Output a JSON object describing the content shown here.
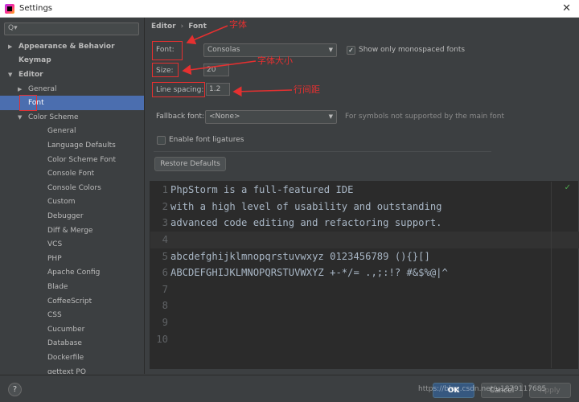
{
  "window": {
    "title": "Settings",
    "close_glyph": "✕"
  },
  "search": {
    "icon": "search-icon",
    "glyph": "Q▾"
  },
  "tree": [
    {
      "label": "Appearance & Behavior",
      "bold": true,
      "arrow": "▶",
      "indent": 0
    },
    {
      "label": "Keymap",
      "bold": true,
      "arrow": "",
      "indent": 0
    },
    {
      "label": "Editor",
      "bold": true,
      "arrow": "▼",
      "indent": 0
    },
    {
      "label": "General",
      "bold": false,
      "arrow": "▶",
      "indent": 1
    },
    {
      "label": "Font",
      "bold": false,
      "arrow": "",
      "indent": 1,
      "selected": true
    },
    {
      "label": "Color Scheme",
      "bold": false,
      "arrow": "▼",
      "indent": 1
    },
    {
      "label": "General",
      "bold": false,
      "arrow": "",
      "indent": 2
    },
    {
      "label": "Language Defaults",
      "bold": false,
      "arrow": "",
      "indent": 2
    },
    {
      "label": "Color Scheme Font",
      "bold": false,
      "arrow": "",
      "indent": 2
    },
    {
      "label": "Console Font",
      "bold": false,
      "arrow": "",
      "indent": 2
    },
    {
      "label": "Console Colors",
      "bold": false,
      "arrow": "",
      "indent": 2
    },
    {
      "label": "Custom",
      "bold": false,
      "arrow": "",
      "indent": 2
    },
    {
      "label": "Debugger",
      "bold": false,
      "arrow": "",
      "indent": 2
    },
    {
      "label": "Diff & Merge",
      "bold": false,
      "arrow": "",
      "indent": 2
    },
    {
      "label": "VCS",
      "bold": false,
      "arrow": "",
      "indent": 2
    },
    {
      "label": "PHP",
      "bold": false,
      "arrow": "",
      "indent": 2
    },
    {
      "label": "Apache Config",
      "bold": false,
      "arrow": "",
      "indent": 2
    },
    {
      "label": "Blade",
      "bold": false,
      "arrow": "",
      "indent": 2
    },
    {
      "label": "CoffeeScript",
      "bold": false,
      "arrow": "",
      "indent": 2
    },
    {
      "label": "CSS",
      "bold": false,
      "arrow": "",
      "indent": 2
    },
    {
      "label": "Cucumber",
      "bold": false,
      "arrow": "",
      "indent": 2
    },
    {
      "label": "Database",
      "bold": false,
      "arrow": "",
      "indent": 2
    },
    {
      "label": "Dockerfile",
      "bold": false,
      "arrow": "",
      "indent": 2
    },
    {
      "label": "gettext PO",
      "bold": false,
      "arrow": "",
      "indent": 2
    }
  ],
  "breadcrumb": {
    "editor": "Editor",
    "sep": "›",
    "font": "Font"
  },
  "font": {
    "label": "Font:",
    "value": "Consolas",
    "show_mono_label": "Show only monospaced fonts",
    "show_mono_checked": "✓"
  },
  "size": {
    "label": "Size:",
    "value": "20"
  },
  "line_spacing": {
    "label": "Line spacing:",
    "value": "1.2"
  },
  "fallback": {
    "label": "Fallback font:",
    "value": "<None>",
    "hint": "For symbols not supported by the main font"
  },
  "ligatures": {
    "label": "Enable font ligatures",
    "checked": ""
  },
  "restore_label": "Restore Defaults",
  "annotations": {
    "font": "字体",
    "size": "字体大小",
    "spacing": "行间距",
    "color": "#e53030"
  },
  "preview": {
    "lines": [
      {
        "n": "1",
        "text": "PhpStorm is a full-featured IDE"
      },
      {
        "n": "2",
        "text": "with a high level of usability and outstanding"
      },
      {
        "n": "3",
        "text": "advanced code editing and refactoring support."
      },
      {
        "n": "4",
        "text": ""
      },
      {
        "n": "5",
        "text": "abcdefghijklmnopqrstuvwxyz 0123456789 (){}[]"
      },
      {
        "n": "6",
        "text": "ABCDEFGHIJKLMNOPQRSTUVWXYZ +-*/= .,;:!? #&$%@|^"
      },
      {
        "n": "7",
        "text": ""
      },
      {
        "n": "8",
        "text": ""
      },
      {
        "n": "9",
        "text": ""
      },
      {
        "n": "10",
        "text": ""
      }
    ],
    "check_glyph": "✓"
  },
  "footer": {
    "help": "?",
    "ok": "OK",
    "cancel": "Cancel",
    "apply": "Apply"
  },
  "watermark": "https://blog.csdn.net/u1879117685"
}
